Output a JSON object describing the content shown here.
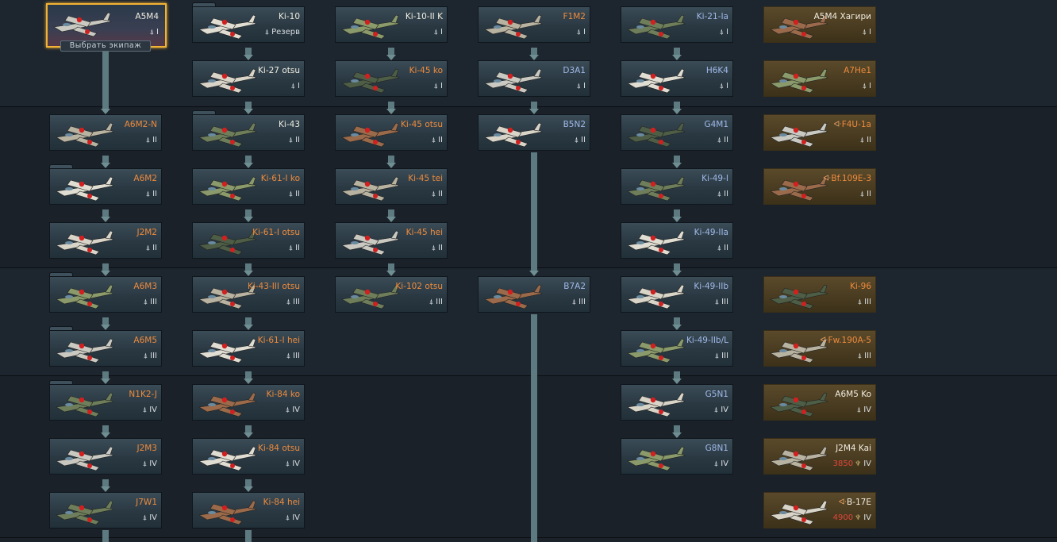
{
  "select_crew": "Выбрать экипаж",
  "vehicles": [
    {
      "id": "a5m4",
      "name": "A5M4",
      "rank": "I",
      "color": "white"
    },
    {
      "id": "ki10",
      "name": "Ki-10",
      "rank": "Резерв",
      "color": "white"
    },
    {
      "id": "ki10iik",
      "name": "Ki-10-II K",
      "rank": "I",
      "color": "white"
    },
    {
      "id": "f1m2",
      "name": "F1M2",
      "rank": "I",
      "color": "orange"
    },
    {
      "id": "ki21ia",
      "name": "Ki-21-Ia",
      "rank": "I",
      "color": "blue"
    },
    {
      "id": "a5m4hagiri",
      "name": "A5M4 Хагири",
      "rank": "I",
      "color": "white"
    },
    {
      "id": "ki27otsu",
      "name": "Ki-27 otsu",
      "rank": "I",
      "color": "white"
    },
    {
      "id": "ki45ko",
      "name": "Ki-45 ko",
      "rank": "I",
      "color": "orange"
    },
    {
      "id": "d3a1",
      "name": "D3A1",
      "rank": "I",
      "color": "blue"
    },
    {
      "id": "h6k4",
      "name": "H6K4",
      "rank": "I",
      "color": "blue"
    },
    {
      "id": "a7he1",
      "name": "A7He1",
      "rank": "I",
      "color": "orange"
    },
    {
      "id": "a6m2n",
      "name": "A6M2-N",
      "rank": "II",
      "color": "orange"
    },
    {
      "id": "ki43",
      "name": "Ki-43",
      "rank": "II",
      "color": "white"
    },
    {
      "id": "ki45otsu",
      "name": "Ki-45 otsu",
      "rank": "II",
      "color": "orange"
    },
    {
      "id": "b5n2",
      "name": "B5N2",
      "rank": "II",
      "color": "blue"
    },
    {
      "id": "g4m1",
      "name": "G4M1",
      "rank": "II",
      "color": "blue"
    },
    {
      "id": "f4u1a",
      "name": "F4U-1a",
      "rank": "II",
      "color": "orange",
      "premium_mark": "ᐘ"
    },
    {
      "id": "a6m2",
      "name": "A6M2",
      "rank": "II",
      "color": "orange"
    },
    {
      "id": "ki61iko",
      "name": "Ki-61-I ko",
      "rank": "II",
      "color": "orange"
    },
    {
      "id": "ki45tei",
      "name": "Ki-45 tei",
      "rank": "II",
      "color": "orange"
    },
    {
      "id": "ki49i",
      "name": "Ki-49-I",
      "rank": "II",
      "color": "blue"
    },
    {
      "id": "bf109e3",
      "name": "Bf.109E-3",
      "rank": "II",
      "color": "orange",
      "premium_mark": "ᐘ"
    },
    {
      "id": "j2m2",
      "name": "J2M2",
      "rank": "II",
      "color": "orange"
    },
    {
      "id": "ki61iotsu",
      "name": "Ki-61-I otsu",
      "rank": "II",
      "color": "orange"
    },
    {
      "id": "ki45hei",
      "name": "Ki-45 hei",
      "rank": "II",
      "color": "orange"
    },
    {
      "id": "ki49iia",
      "name": "Ki-49-IIa",
      "rank": "II",
      "color": "blue"
    },
    {
      "id": "a6m3",
      "name": "A6M3",
      "rank": "III",
      "color": "orange"
    },
    {
      "id": "ki43iiiotsu",
      "name": "Ki-43-III otsu",
      "rank": "III",
      "color": "orange"
    },
    {
      "id": "ki102otsu",
      "name": "Ki-102 otsu",
      "rank": "III",
      "color": "orange"
    },
    {
      "id": "b7a2",
      "name": "B7A2",
      "rank": "III",
      "color": "blue"
    },
    {
      "id": "ki49iib",
      "name": "Ki-49-IIb",
      "rank": "III",
      "color": "blue"
    },
    {
      "id": "ki96",
      "name": "Ki-96",
      "rank": "III",
      "color": "orange"
    },
    {
      "id": "a6m5",
      "name": "A6M5",
      "rank": "III",
      "color": "orange"
    },
    {
      "id": "ki61ihei",
      "name": "Ki-61-I hei",
      "rank": "III",
      "color": "orange"
    },
    {
      "id": "ki49iibl",
      "name": "Ki-49-IIb/L",
      "rank": "III",
      "color": "blue"
    },
    {
      "id": "fw190a5",
      "name": "Fw.190A-5",
      "rank": "III",
      "color": "orange",
      "premium_mark": "ᐘ"
    },
    {
      "id": "n1k2j",
      "name": "N1K2-J",
      "rank": "IV",
      "color": "orange"
    },
    {
      "id": "ki84ko",
      "name": "Ki-84 ko",
      "rank": "IV",
      "color": "orange"
    },
    {
      "id": "g5n1",
      "name": "G5N1",
      "rank": "IV",
      "color": "blue"
    },
    {
      "id": "a6m5ko",
      "name": "A6M5 Ko",
      "rank": "IV",
      "color": "white"
    },
    {
      "id": "j2m3",
      "name": "J2M3",
      "rank": "IV",
      "color": "orange"
    },
    {
      "id": "ki84otsu",
      "name": "Ki-84 otsu",
      "rank": "IV",
      "color": "orange"
    },
    {
      "id": "g8n1",
      "name": "G8N1",
      "rank": "IV",
      "color": "blue"
    },
    {
      "id": "j2m4kai",
      "name": "J2M4 Kai",
      "rank": "IV",
      "color": "white",
      "price": "3850"
    },
    {
      "id": "j7w1",
      "name": "J7W1",
      "rank": "IV",
      "color": "orange"
    },
    {
      "id": "ki84hei",
      "name": "Ki-84 hei",
      "rank": "IV",
      "color": "orange"
    },
    {
      "id": "b17e",
      "name": "B-17E",
      "rank": "IV",
      "color": "white",
      "price": "4900",
      "premium_mark": "ᐘ"
    }
  ],
  "colors": {
    "orange": "#ee8a3c",
    "blue": "#a0b8e8",
    "white": "#f0ece0",
    "selected": "#f2b233"
  }
}
